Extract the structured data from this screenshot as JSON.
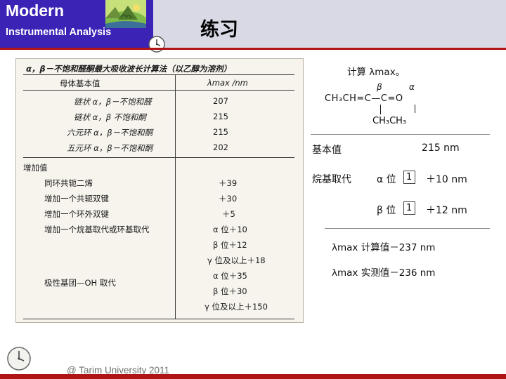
{
  "header": {
    "title_line1": "Modern",
    "title_line2": "Instrumental Analysis",
    "chinese_title": "练习",
    "logo_icon": "mountain-landscape-logo",
    "clock_icon": "clock-icon"
  },
  "left_table": {
    "caption": "α，β－不饱和醛酮最大吸收波长计算法（以乙醇为溶剂）",
    "col_header_left": "母体基本值",
    "col_header_right": "λmax /nm",
    "base_rows": [
      {
        "label": "链状 α，β－不饱和醛",
        "value": "207"
      },
      {
        "label": "链状 α，β  不饱和酮",
        "value": "215"
      },
      {
        "label": "六元环 α，β－不饱和酮",
        "value": "215"
      },
      {
        "label": "五元环 α，β－不饱和酮",
        "value": "202"
      }
    ],
    "increment_header": "增加值",
    "increment_rows": [
      {
        "label": "同环共轭二烯",
        "value": "＋39"
      },
      {
        "label": "增加一个共轭双键",
        "value": "＋30"
      },
      {
        "label": "增加一个环外双键",
        "value": "＋5"
      },
      {
        "label": "增加一个烷基取代或环基取代",
        "value": "α 位＋10"
      },
      {
        "label": "",
        "value": "β 位＋12"
      },
      {
        "label": "",
        "value": "γ 位及以上＋18"
      },
      {
        "label": "极性基团—OH 取代",
        "value": "α 位＋35"
      },
      {
        "label": "",
        "value": "β 位＋30"
      },
      {
        "label": "",
        "value": "γ 位及以上＋150"
      }
    ]
  },
  "right_panel": {
    "prompt": "计算 λmax。",
    "structure": {
      "beta_label": "β",
      "alpha_label": "α",
      "main_chain": "CH₃CH=C—C=O",
      "sub_chain": "CH₃CH₃"
    },
    "rows": [
      {
        "label": "基本值",
        "boxed": "",
        "value": "215 nm"
      },
      {
        "label": "烷基取代",
        "position": "α 位",
        "boxed": "1",
        "value": "＋10 nm"
      },
      {
        "label": "",
        "position": "β 位",
        "boxed": "1",
        "value": "＋12 nm"
      }
    ],
    "results": [
      "λmax 计算值－237 nm",
      "λmax 实测值－236 nm"
    ]
  },
  "footer": {
    "credit": "@ Tarim University 2011",
    "clock_icon": "clock-icon"
  },
  "colors": {
    "header_left_bg": "#3b23b5",
    "header_band_bg": "#d9d9e6",
    "accent_red": "#b01515",
    "scan_bg": "#f7f4ee"
  }
}
